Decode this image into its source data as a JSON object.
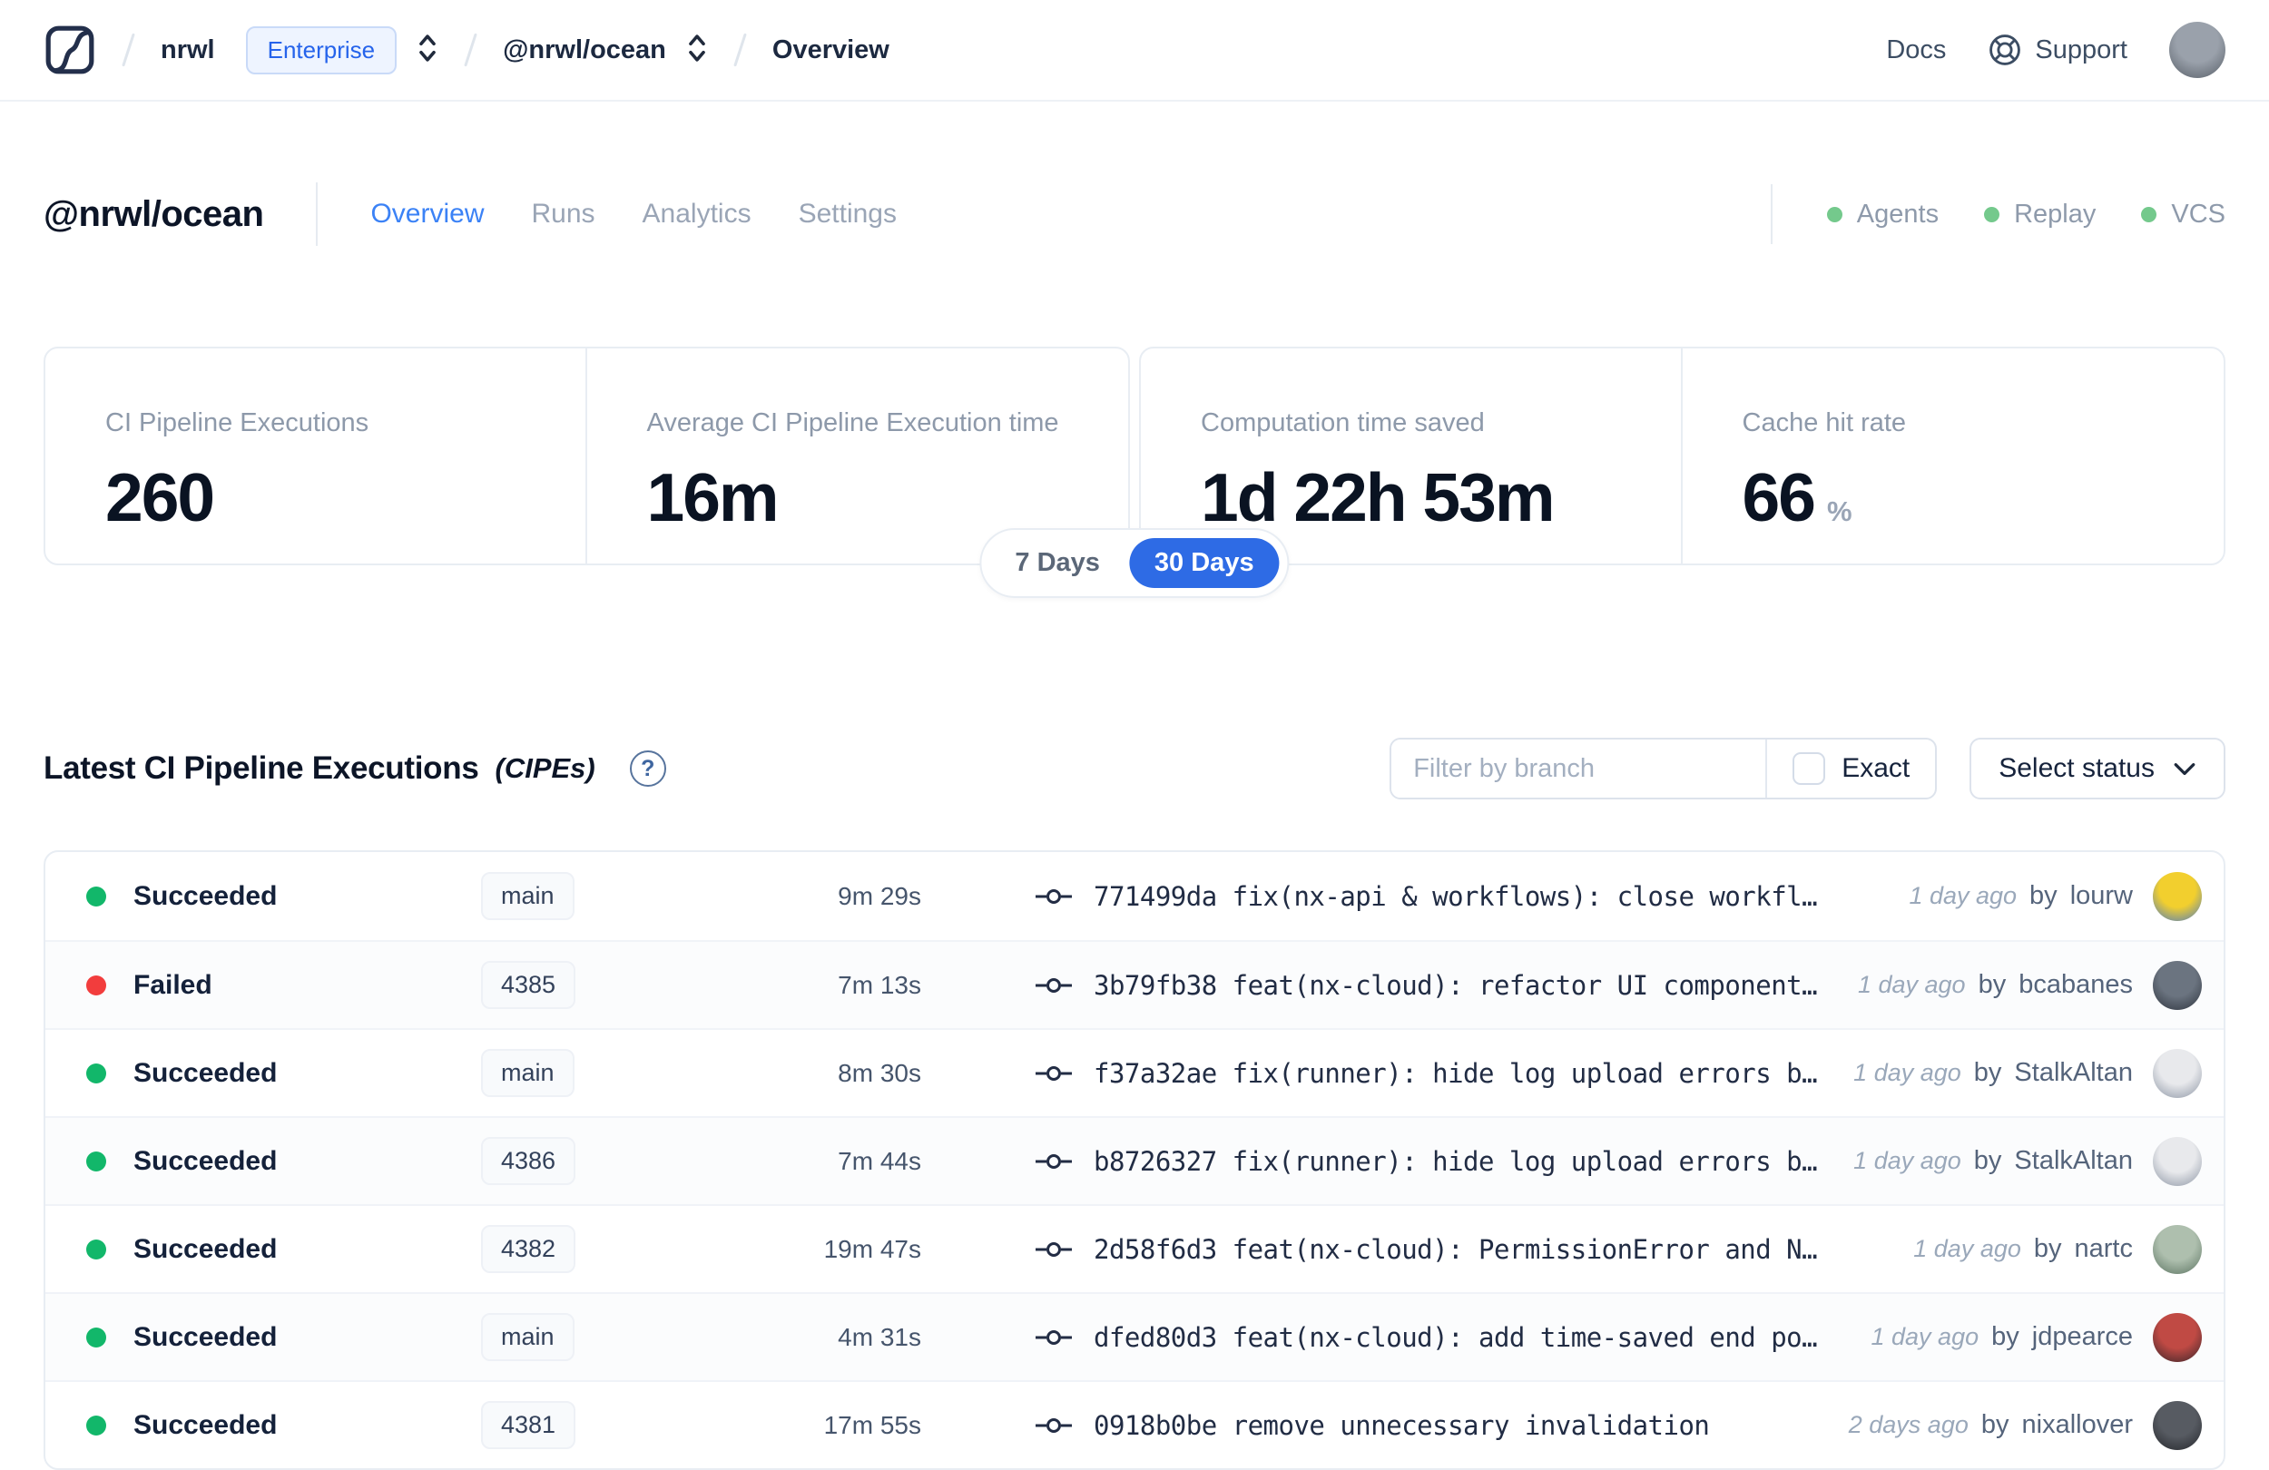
{
  "header": {
    "breadcrumb": {
      "org": "nrwl",
      "org_badge": "Enterprise",
      "workspace": "@nrwl/ocean",
      "page": "Overview"
    },
    "links": {
      "docs": "Docs",
      "support": "Support"
    }
  },
  "workspace": {
    "title": "@nrwl/ocean",
    "tabs": [
      {
        "label": "Overview",
        "active": true
      },
      {
        "label": "Runs",
        "active": false
      },
      {
        "label": "Analytics",
        "active": false
      },
      {
        "label": "Settings",
        "active": false
      }
    ],
    "services": [
      {
        "label": "Agents"
      },
      {
        "label": "Replay"
      },
      {
        "label": "VCS"
      }
    ],
    "service_dot_color": "#74c98c"
  },
  "stats": {
    "cards": [
      {
        "label": "CI Pipeline Executions",
        "value": "260"
      },
      {
        "label": "Average CI Pipeline Execution time",
        "value": "16m"
      },
      {
        "label": "Computation time saved",
        "value": "1d 22h 53m"
      },
      {
        "label": "Cache hit rate",
        "value": "66",
        "unit": "%"
      }
    ],
    "range_toggle": {
      "options": [
        "7 Days",
        "30 Days"
      ],
      "selected": "30 Days",
      "active_color": "#2e6be5"
    }
  },
  "cipe_section": {
    "title": "Latest CI Pipeline Executions",
    "title_suffix": "(CIPEs)",
    "help_glyph": "?",
    "filter_placeholder": "Filter by branch",
    "exact_label": "Exact",
    "exact_checked": false,
    "status_dropdown_label": "Select status"
  },
  "table": {
    "by_label": "by",
    "status_colors": {
      "succeeded": "#12b76a",
      "failed": "#f23d3d"
    },
    "rows": [
      {
        "status": "Succeeded",
        "status_color": "#12b76a",
        "branch": "main",
        "duration": "9m 29s",
        "commit": "771499da fix(nx-api & workflows): close workfl…",
        "time_ago": "1 day ago",
        "author": "lourw",
        "avatar": {
          "c1": "#f2cf2e",
          "c2": "#4a79c4"
        }
      },
      {
        "status": "Failed",
        "status_color": "#f23d3d",
        "branch": "4385",
        "duration": "7m 13s",
        "commit": "3b79fb38 feat(nx-cloud): refactor UI component…",
        "time_ago": "1 day ago",
        "author": "bcabanes",
        "avatar": {
          "c1": "#6b7480",
          "c2": "#2d333d"
        }
      },
      {
        "status": "Succeeded",
        "status_color": "#12b76a",
        "branch": "main",
        "duration": "8m 30s",
        "commit": "f37a32ae fix(runner): hide log upload errors b…",
        "time_ago": "1 day ago",
        "author": "StalkAltan",
        "avatar": {
          "c1": "#e8e9ec",
          "c2": "#8b94a3"
        }
      },
      {
        "status": "Succeeded",
        "status_color": "#12b76a",
        "branch": "4386",
        "duration": "7m 44s",
        "commit": "b8726327 fix(runner): hide log upload errors b…",
        "time_ago": "1 day ago",
        "author": "StalkAltan",
        "avatar": {
          "c1": "#e8e9ec",
          "c2": "#8b94a3"
        }
      },
      {
        "status": "Succeeded",
        "status_color": "#12b76a",
        "branch": "4382",
        "duration": "19m 47s",
        "commit": "2d58f6d3 feat(nx-cloud): PermissionError and N…",
        "time_ago": "1 day ago",
        "author": "nartc",
        "avatar": {
          "c1": "#aebfae",
          "c2": "#5a7260"
        }
      },
      {
        "status": "Succeeded",
        "status_color": "#12b76a",
        "branch": "main",
        "duration": "4m 31s",
        "commit": "dfed80d3 feat(nx-cloud): add time-saved end po…",
        "time_ago": "1 day ago",
        "author": "jdpearce",
        "avatar": {
          "c1": "#c04a44",
          "c2": "#35242a"
        }
      },
      {
        "status": "Succeeded",
        "status_color": "#12b76a",
        "branch": "4381",
        "duration": "17m 55s",
        "commit": "0918b0be remove unnecessary invalidation",
        "time_ago": "2 days ago",
        "author": "nixallover",
        "avatar": {
          "c1": "#575b62",
          "c2": "#24262b"
        }
      }
    ]
  },
  "avatars": {
    "header": {
      "c1": "#9aa1ab",
      "c2": "#565d66"
    }
  }
}
